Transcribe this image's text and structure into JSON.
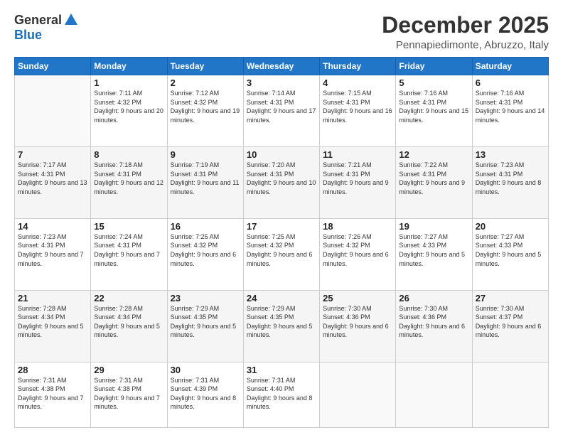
{
  "header": {
    "logo_general": "General",
    "logo_blue": "Blue",
    "month_title": "December 2025",
    "location": "Pennapiedimonte, Abruzzo, Italy"
  },
  "days_of_week": [
    "Sunday",
    "Monday",
    "Tuesday",
    "Wednesday",
    "Thursday",
    "Friday",
    "Saturday"
  ],
  "weeks": [
    [
      {
        "day": "",
        "sunrise": "",
        "sunset": "",
        "daylight": ""
      },
      {
        "day": "1",
        "sunrise": "Sunrise: 7:11 AM",
        "sunset": "Sunset: 4:32 PM",
        "daylight": "Daylight: 9 hours and 20 minutes."
      },
      {
        "day": "2",
        "sunrise": "Sunrise: 7:12 AM",
        "sunset": "Sunset: 4:32 PM",
        "daylight": "Daylight: 9 hours and 19 minutes."
      },
      {
        "day": "3",
        "sunrise": "Sunrise: 7:14 AM",
        "sunset": "Sunset: 4:31 PM",
        "daylight": "Daylight: 9 hours and 17 minutes."
      },
      {
        "day": "4",
        "sunrise": "Sunrise: 7:15 AM",
        "sunset": "Sunset: 4:31 PM",
        "daylight": "Daylight: 9 hours and 16 minutes."
      },
      {
        "day": "5",
        "sunrise": "Sunrise: 7:16 AM",
        "sunset": "Sunset: 4:31 PM",
        "daylight": "Daylight: 9 hours and 15 minutes."
      },
      {
        "day": "6",
        "sunrise": "Sunrise: 7:16 AM",
        "sunset": "Sunset: 4:31 PM",
        "daylight": "Daylight: 9 hours and 14 minutes."
      }
    ],
    [
      {
        "day": "7",
        "sunrise": "Sunrise: 7:17 AM",
        "sunset": "Sunset: 4:31 PM",
        "daylight": "Daylight: 9 hours and 13 minutes."
      },
      {
        "day": "8",
        "sunrise": "Sunrise: 7:18 AM",
        "sunset": "Sunset: 4:31 PM",
        "daylight": "Daylight: 9 hours and 12 minutes."
      },
      {
        "day": "9",
        "sunrise": "Sunrise: 7:19 AM",
        "sunset": "Sunset: 4:31 PM",
        "daylight": "Daylight: 9 hours and 11 minutes."
      },
      {
        "day": "10",
        "sunrise": "Sunrise: 7:20 AM",
        "sunset": "Sunset: 4:31 PM",
        "daylight": "Daylight: 9 hours and 10 minutes."
      },
      {
        "day": "11",
        "sunrise": "Sunrise: 7:21 AM",
        "sunset": "Sunset: 4:31 PM",
        "daylight": "Daylight: 9 hours and 9 minutes."
      },
      {
        "day": "12",
        "sunrise": "Sunrise: 7:22 AM",
        "sunset": "Sunset: 4:31 PM",
        "daylight": "Daylight: 9 hours and 9 minutes."
      },
      {
        "day": "13",
        "sunrise": "Sunrise: 7:23 AM",
        "sunset": "Sunset: 4:31 PM",
        "daylight": "Daylight: 9 hours and 8 minutes."
      }
    ],
    [
      {
        "day": "14",
        "sunrise": "Sunrise: 7:23 AM",
        "sunset": "Sunset: 4:31 PM",
        "daylight": "Daylight: 9 hours and 7 minutes."
      },
      {
        "day": "15",
        "sunrise": "Sunrise: 7:24 AM",
        "sunset": "Sunset: 4:31 PM",
        "daylight": "Daylight: 9 hours and 7 minutes."
      },
      {
        "day": "16",
        "sunrise": "Sunrise: 7:25 AM",
        "sunset": "Sunset: 4:32 PM",
        "daylight": "Daylight: 9 hours and 6 minutes."
      },
      {
        "day": "17",
        "sunrise": "Sunrise: 7:25 AM",
        "sunset": "Sunset: 4:32 PM",
        "daylight": "Daylight: 9 hours and 6 minutes."
      },
      {
        "day": "18",
        "sunrise": "Sunrise: 7:26 AM",
        "sunset": "Sunset: 4:32 PM",
        "daylight": "Daylight: 9 hours and 6 minutes."
      },
      {
        "day": "19",
        "sunrise": "Sunrise: 7:27 AM",
        "sunset": "Sunset: 4:33 PM",
        "daylight": "Daylight: 9 hours and 5 minutes."
      },
      {
        "day": "20",
        "sunrise": "Sunrise: 7:27 AM",
        "sunset": "Sunset: 4:33 PM",
        "daylight": "Daylight: 9 hours and 5 minutes."
      }
    ],
    [
      {
        "day": "21",
        "sunrise": "Sunrise: 7:28 AM",
        "sunset": "Sunset: 4:34 PM",
        "daylight": "Daylight: 9 hours and 5 minutes."
      },
      {
        "day": "22",
        "sunrise": "Sunrise: 7:28 AM",
        "sunset": "Sunset: 4:34 PM",
        "daylight": "Daylight: 9 hours and 5 minutes."
      },
      {
        "day": "23",
        "sunrise": "Sunrise: 7:29 AM",
        "sunset": "Sunset: 4:35 PM",
        "daylight": "Daylight: 9 hours and 5 minutes."
      },
      {
        "day": "24",
        "sunrise": "Sunrise: 7:29 AM",
        "sunset": "Sunset: 4:35 PM",
        "daylight": "Daylight: 9 hours and 5 minutes."
      },
      {
        "day": "25",
        "sunrise": "Sunrise: 7:30 AM",
        "sunset": "Sunset: 4:36 PM",
        "daylight": "Daylight: 9 hours and 6 minutes."
      },
      {
        "day": "26",
        "sunrise": "Sunrise: 7:30 AM",
        "sunset": "Sunset: 4:36 PM",
        "daylight": "Daylight: 9 hours and 6 minutes."
      },
      {
        "day": "27",
        "sunrise": "Sunrise: 7:30 AM",
        "sunset": "Sunset: 4:37 PM",
        "daylight": "Daylight: 9 hours and 6 minutes."
      }
    ],
    [
      {
        "day": "28",
        "sunrise": "Sunrise: 7:31 AM",
        "sunset": "Sunset: 4:38 PM",
        "daylight": "Daylight: 9 hours and 7 minutes."
      },
      {
        "day": "29",
        "sunrise": "Sunrise: 7:31 AM",
        "sunset": "Sunset: 4:38 PM",
        "daylight": "Daylight: 9 hours and 7 minutes."
      },
      {
        "day": "30",
        "sunrise": "Sunrise: 7:31 AM",
        "sunset": "Sunset: 4:39 PM",
        "daylight": "Daylight: 9 hours and 8 minutes."
      },
      {
        "day": "31",
        "sunrise": "Sunrise: 7:31 AM",
        "sunset": "Sunset: 4:40 PM",
        "daylight": "Daylight: 9 hours and 8 minutes."
      },
      {
        "day": "",
        "sunrise": "",
        "sunset": "",
        "daylight": ""
      },
      {
        "day": "",
        "sunrise": "",
        "sunset": "",
        "daylight": ""
      },
      {
        "day": "",
        "sunrise": "",
        "sunset": "",
        "daylight": ""
      }
    ]
  ]
}
